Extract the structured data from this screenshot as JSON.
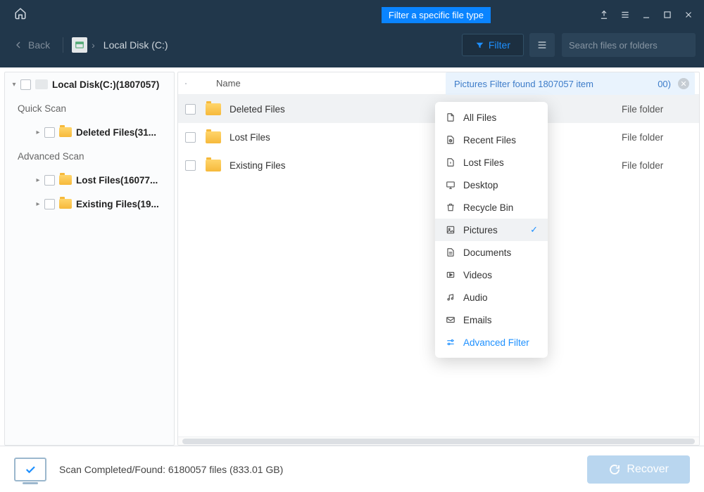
{
  "hint": "Filter a specific file type",
  "toolbar": {
    "back_label": "Back",
    "crumb": "Local Disk (C:)",
    "filter_label": "Filter",
    "search_placeholder": "Search files or folders"
  },
  "sidebar": {
    "root_label": "Local Disk(C:)(1807057)",
    "section_quick": "Quick Scan",
    "deleted_label": "Deleted Files(31...",
    "section_adv": "Advanced Scan",
    "lost_label": "Lost Files(16077...",
    "existing_label": "Existing Files(19..."
  },
  "columns": {
    "name": "Name"
  },
  "banner": {
    "text": "Pictures Filter found 1807057 item",
    "tail": "00)"
  },
  "rows": {
    "deleted": {
      "name": "Deleted Files",
      "type": "File folder"
    },
    "lost": {
      "name": "Lost Files",
      "type": "File folder"
    },
    "existing": {
      "name": "Existing Files",
      "type": "File folder"
    }
  },
  "dropdown": {
    "all": "All Files",
    "recent": "Recent Files",
    "lost": "Lost Files",
    "desktop": "Desktop",
    "recycle": "Recycle Bin",
    "pictures": "Pictures",
    "documents": "Documents",
    "videos": "Videos",
    "audio": "Audio",
    "emails": "Emails",
    "advanced": "Advanced Filter"
  },
  "footer": {
    "status": "Scan Completed/Found: 6180057 files (833.01 GB)",
    "recover": "Recover"
  }
}
